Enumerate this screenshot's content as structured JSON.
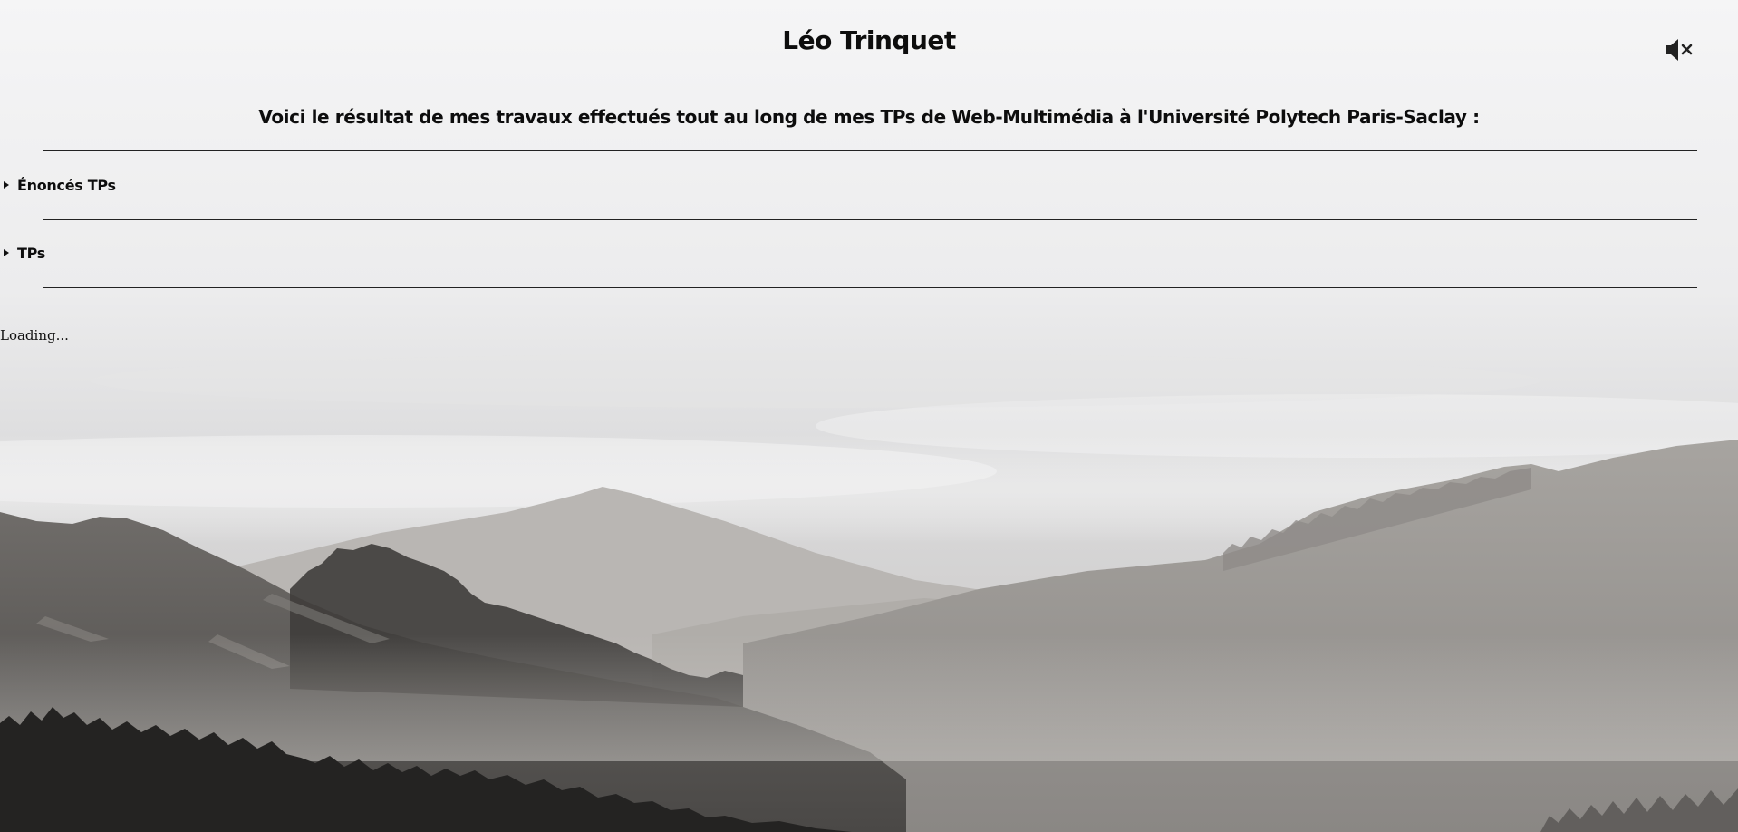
{
  "header": {
    "title": "Léo Trinquet",
    "mute_icon": "speaker-muted-icon"
  },
  "intro": {
    "text": "Voici le résultat de mes travaux effectués tout au long de mes TPs de Web-Multimédia à l'Université Polytech Paris-Saclay :"
  },
  "sections": [
    {
      "label": "Énoncés TPs",
      "expanded": false
    },
    {
      "label": "TPs",
      "expanded": false
    }
  ],
  "status": {
    "text": "Loading..."
  }
}
